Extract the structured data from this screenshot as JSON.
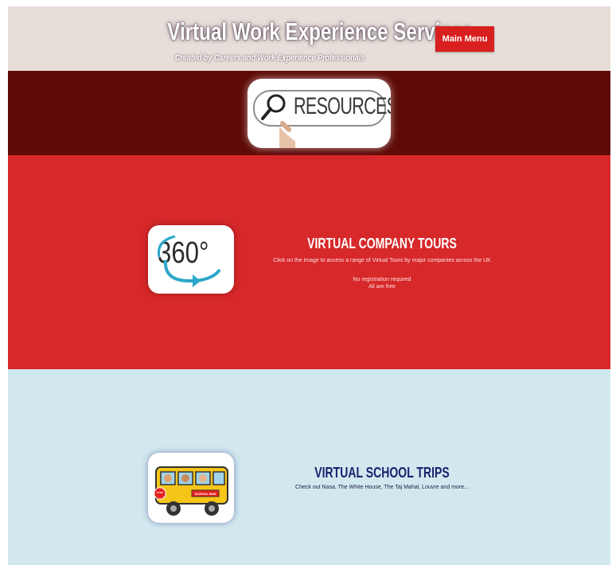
{
  "header": {
    "title": "Virtual Work Experience Services",
    "subtitle": "Created by Careers and Work Experience Professionals",
    "menu_button": "Main Menu"
  },
  "resources": {
    "image_text": "RESOURCES",
    "icon": "magnifier-icon"
  },
  "tours": {
    "image_text": "360°",
    "title": "VIRTUAL COMPANY TOURS",
    "description": "Click on the image to access a range of Virtual Tours by major companies across the UK",
    "note_1": "No registration required",
    "note_2": "All are free"
  },
  "trips": {
    "image_sign": "STOP",
    "image_banner": "SCHOOL BUS",
    "title": "VIRTUAL SCHOOL TRIPS",
    "description": "Check out Nasa, The White House, The Taj Mahal, Louvre and more..."
  },
  "colors": {
    "header_bg": "#e7ddd9",
    "accent_red": "#d8201f",
    "dark_band": "#5e0a06",
    "tours_bg": "#d7282a",
    "trips_bg": "#d1e8ef",
    "trips_title": "#1c1f6e"
  }
}
